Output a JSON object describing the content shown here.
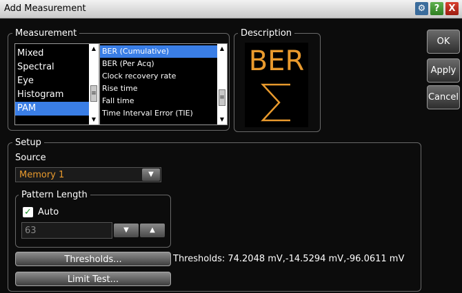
{
  "window": {
    "title": "Add Measurement",
    "gear_icon": "gear-icon",
    "help_label": "?",
    "close_label": "X"
  },
  "measurement": {
    "legend": "Measurement",
    "categories": [
      "Mixed",
      "Spectral",
      "Eye",
      "Histogram",
      "PAM"
    ],
    "selected_category": "PAM",
    "items": [
      "BER (Cumulative)",
      "BER (Per Acq)",
      "Clock recovery rate",
      "Rise time",
      "Fall time",
      "Time Interval Error (TIE)"
    ],
    "selected_item": "BER (Cumulative)"
  },
  "description": {
    "legend": "Description",
    "icon_text": "BER"
  },
  "buttons": {
    "ok": "OK",
    "apply": "Apply",
    "cancel": "Cancel"
  },
  "setup": {
    "legend": "Setup",
    "source_label": "Source",
    "source_value": "Memory 1",
    "pattern_legend": "Pattern Length",
    "auto_label": "Auto",
    "auto_checked": true,
    "pattern_value": "63",
    "thresholds_button": "Thresholds...",
    "thresholds_text": "Thresholds: 74.2048 mV,-14.5294 mV,-96.0611 mV",
    "limit_button": "Limit Test..."
  },
  "colors": {
    "accent": "#e99a2d",
    "selection": "#3a7ee6"
  }
}
